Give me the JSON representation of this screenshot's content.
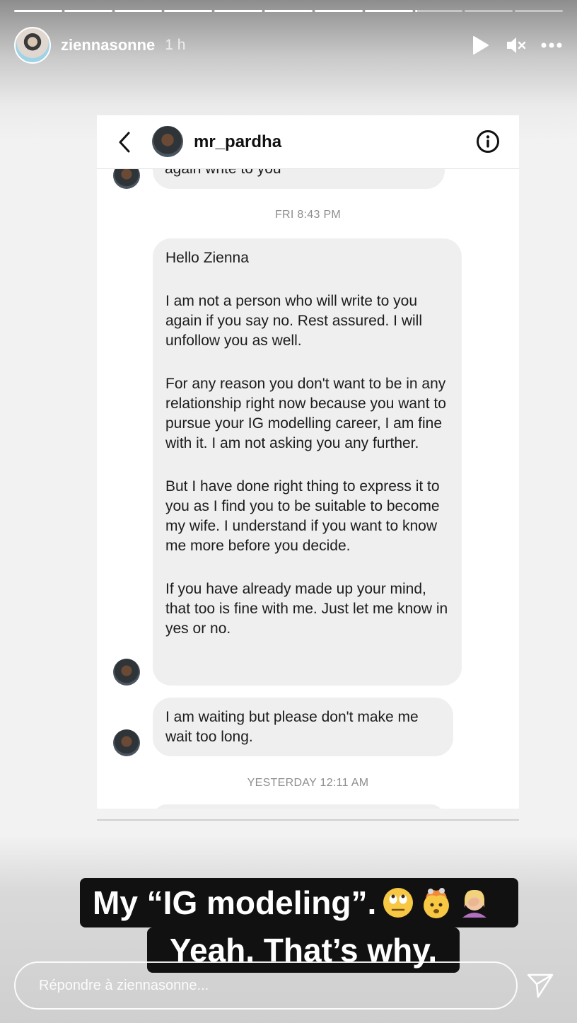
{
  "story": {
    "username": "ziennasonne",
    "time": "1 h",
    "progress": {
      "segments": 11,
      "completed": 8,
      "current_fraction": 0.05
    },
    "icons": {
      "avatar": "story-avatar",
      "play": "play-icon",
      "mute": "mute-icon",
      "more": "more-icon"
    }
  },
  "dm": {
    "username": "mr_pardha",
    "partial_message": "again write to you",
    "timestamp1": "FRI 8:43 PM",
    "message1": [
      "Hello Zienna",
      "I am not a person who will write to you again if you say no.  Rest assured. I will unfollow you as well.",
      "For any reason you don't want to be in any relationship right now because you want to pursue your IG modelling career, I am fine with it.  I am not asking you any further.",
      "But I have done right thing to express it to you as I find you to be suitable to become my wife.  I understand if you want to know me more before you decide.",
      "If you have already made up your mind, that too is fine with me. Just let me know in yes or no."
    ],
    "message2": "I am waiting but please don't make me wait too long.",
    "timestamp2": "YESTERDAY 12:11 AM",
    "icons": {
      "back": "back-arrow-icon",
      "info": "info-icon"
    }
  },
  "caption": {
    "line1": "My “IG modeling”.",
    "line2": "Yeah. That’s why.",
    "emojis": [
      "eye-roll-emoji",
      "exploding-head-emoji",
      "facepalm-emoji"
    ]
  },
  "reply": {
    "placeholder": "Répondre à ziennasonne...",
    "send_icon": "send-icon"
  }
}
